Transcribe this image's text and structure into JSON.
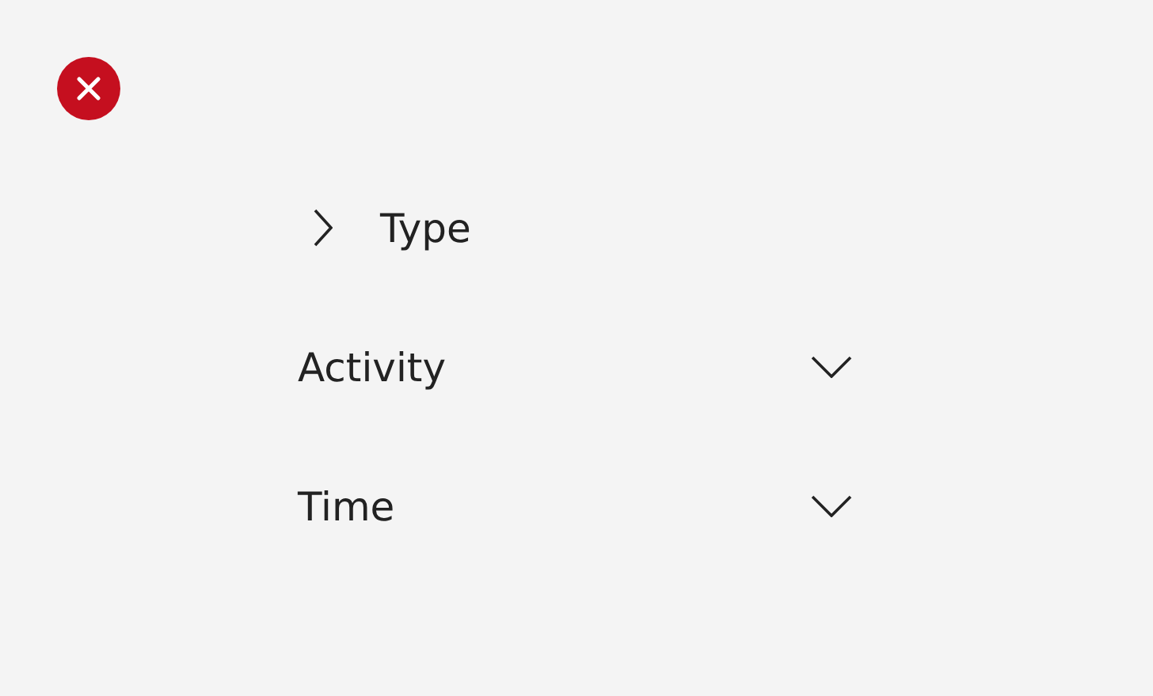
{
  "filters": [
    {
      "label": "Type",
      "kind": "link"
    },
    {
      "label": "Activity",
      "kind": "dropdown"
    },
    {
      "label": "Time",
      "kind": "dropdown"
    }
  ]
}
